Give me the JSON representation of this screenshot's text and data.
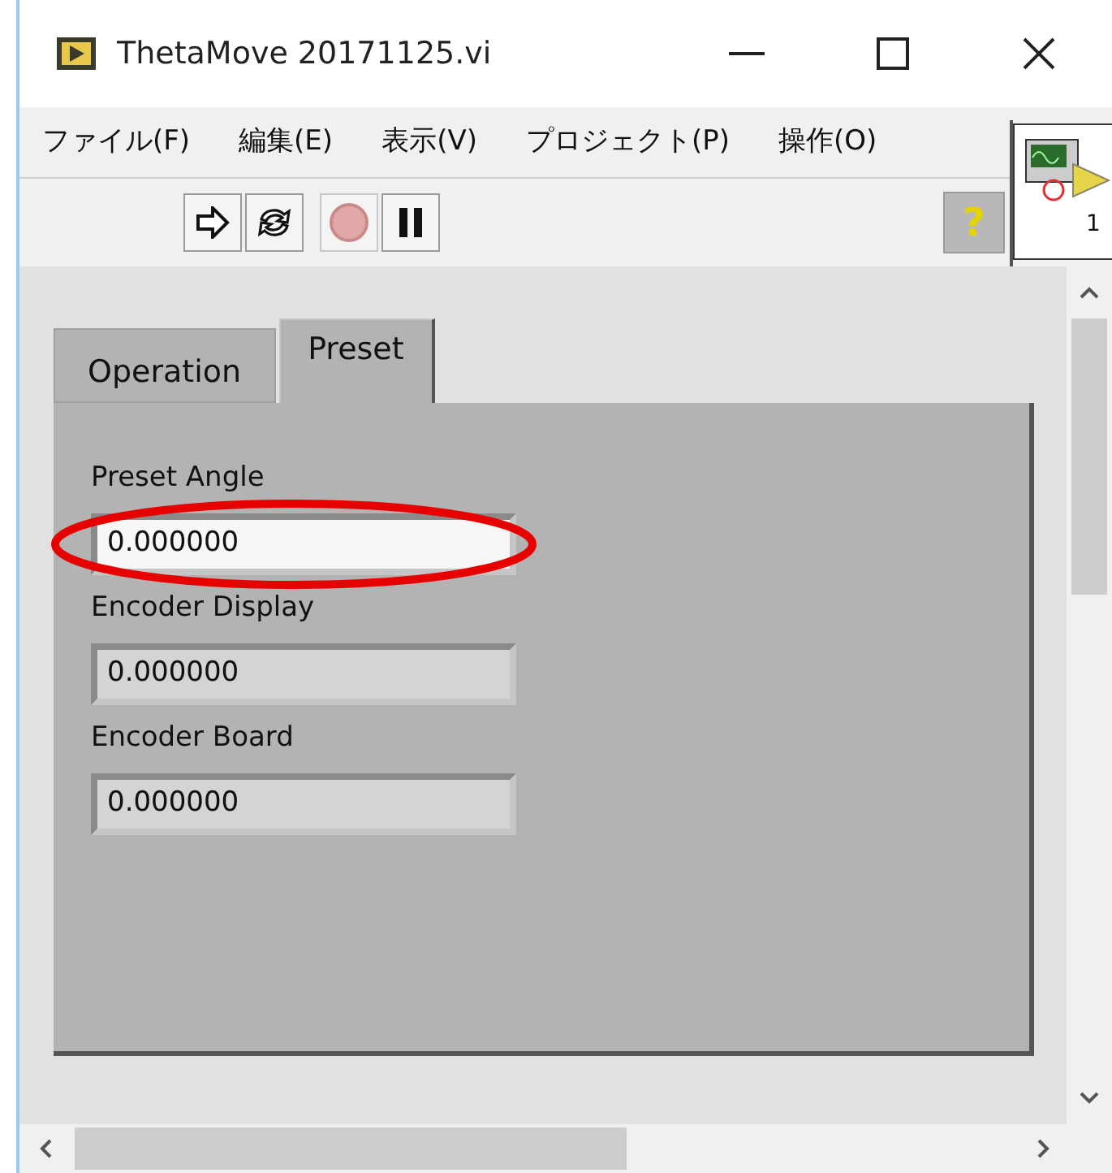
{
  "window": {
    "title": "ThetaMove 20171125.vi"
  },
  "menu": [
    "ファイル(F)",
    "編集(E)",
    "表示(V)",
    "プロジェクト(P)",
    "操作(O)"
  ],
  "connector_pane": {
    "label": "1"
  },
  "toolbar": {
    "help": "?"
  },
  "tabs": [
    {
      "label": "Operation",
      "selected": false
    },
    {
      "label": "Preset",
      "selected": true
    }
  ],
  "fields": [
    {
      "label": "Preset Angle",
      "value": "0.000000",
      "kind": "control",
      "highlighted": true
    },
    {
      "label": "Encoder Display",
      "value": "0.000000",
      "kind": "indicator",
      "highlighted": false
    },
    {
      "label": "Encoder Board",
      "value": "0.000000",
      "kind": "indicator",
      "highlighted": false
    }
  ]
}
